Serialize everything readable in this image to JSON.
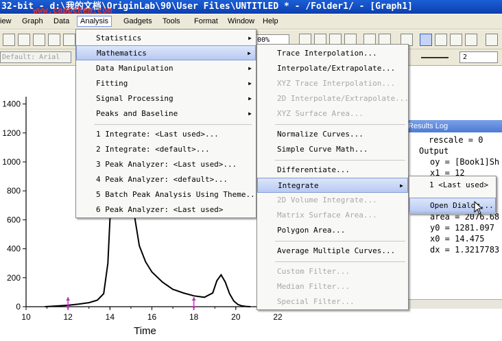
{
  "window": {
    "title": "32-bit - d:\\我的文档\\OriginLab\\90\\User Files\\UNTITLED * - /Folder1/ - [Graph1]",
    "watermark": "www.cappchem.com"
  },
  "menubar": [
    "iew",
    "Graph",
    "Data",
    "Analysis",
    "Gadgets",
    "Tools",
    "Format",
    "Window",
    "Help"
  ],
  "toolbar": {
    "font_name": "Default: Arial",
    "zoom": "00%",
    "line_width": "2"
  },
  "analysis_menu": [
    {
      "label": "Statistics",
      "arrow": true
    },
    {
      "label": "Mathematics",
      "arrow": true
    },
    {
      "label": "Data Manipulation",
      "arrow": true
    },
    {
      "label": "Fitting",
      "arrow": true
    },
    {
      "label": "Signal Processing",
      "arrow": true
    },
    {
      "label": "Peaks and Baseline",
      "arrow": true
    },
    {
      "label": "1 Integrate: <Last used>..."
    },
    {
      "label": "2 Integrate: <default>..."
    },
    {
      "label": "3 Peak Analyzer: <Last used>..."
    },
    {
      "label": "4 Peak Analyzer: <default>..."
    },
    {
      "label": "5 Batch Peak Analysis Using Theme..."
    },
    {
      "label": "6 Peak Analyzer: <Last used>"
    }
  ],
  "math_menu": [
    {
      "label": "Trace Interpolation...",
      "disabled": false
    },
    {
      "label": "Interpolate/Extrapolate...",
      "disabled": false
    },
    {
      "label": "XYZ Trace Interpolation...",
      "disabled": true
    },
    {
      "label": "2D Interpolate/Extrapolate...",
      "disabled": true
    },
    {
      "label": "XYZ Surface Area...",
      "disabled": true
    },
    {
      "label": "Normalize Curves...",
      "disabled": false
    },
    {
      "label": "Simple Curve Math...",
      "disabled": false
    },
    {
      "label": "Differentiate...",
      "disabled": false
    },
    {
      "label": "Integrate",
      "disabled": false
    },
    {
      "label": "2D Volume Integrate...",
      "disabled": true
    },
    {
      "label": "Matrix Surface Area...",
      "disabled": true
    },
    {
      "label": "Polygon Area...",
      "disabled": false
    },
    {
      "label": "Average Multiple Curves...",
      "disabled": false
    },
    {
      "label": "Custom Filter...",
      "disabled": true
    },
    {
      "label": "Median Filter...",
      "disabled": true
    },
    {
      "label": "Special Filter...",
      "disabled": true
    }
  ],
  "integrate_menu": [
    "1 <Last used>",
    "Open Dialog..."
  ],
  "results_log": {
    "title": "Results Log",
    "lines": [
      "rescale = 0",
      "Output",
      "oy = [Book1]Sh",
      "x1 = 12",
      "area = 2076.68",
      "y0 = 1281.097",
      "x0 = 14.475",
      "dx = 1.3217783"
    ]
  },
  "chart_data": {
    "type": "line",
    "xlabel": "Time",
    "ylabel": "",
    "xlim": [
      10,
      22
    ],
    "ylim": [
      0,
      1450
    ],
    "x_ticks": [
      10,
      12,
      14,
      16,
      18,
      20,
      22
    ],
    "y_ticks": [
      0,
      200,
      400,
      600,
      800,
      1000,
      1200,
      1400
    ],
    "series": [
      {
        "x": [
          10.9,
          11.5,
          12.0,
          12.5,
          13.0,
          13.4,
          13.7,
          13.9,
          14.0,
          14.2,
          14.5,
          14.8,
          15.0,
          15.2,
          15.4,
          15.7,
          16.0,
          16.5,
          17.0,
          17.5,
          18.0,
          18.5,
          18.9,
          19.1,
          19.3,
          19.5,
          19.7,
          19.9,
          20.1,
          20.3,
          20.5,
          20.7
        ],
        "y": [
          0,
          5,
          10,
          18,
          28,
          45,
          90,
          300,
          600,
          900,
          1050,
          1000,
          820,
          600,
          420,
          310,
          240,
          170,
          120,
          95,
          75,
          65,
          95,
          180,
          220,
          170,
          90,
          40,
          15,
          5,
          2,
          0
        ]
      }
    ],
    "markers_x": [
      12,
      18
    ]
  }
}
